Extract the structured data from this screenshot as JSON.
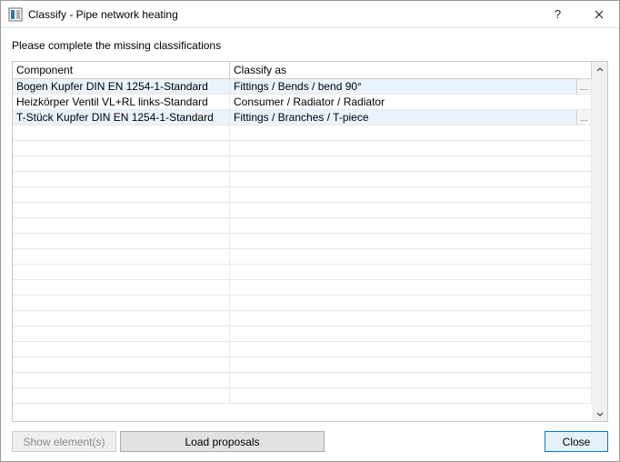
{
  "window": {
    "title": "Classify - Pipe network heating",
    "help_label": "?",
    "close_label": "Close"
  },
  "instruction": "Please complete the missing classifications",
  "grid": {
    "headers": {
      "component": "Component",
      "classify_as": "Classify as"
    },
    "rows": [
      {
        "component": "Bogen Kupfer DIN EN 1254-1-Standard",
        "classify_as": "Fittings / Bends / bend 90°",
        "highlight": true,
        "has_ellipsis": true
      },
      {
        "component": "Heizkörper Ventil VL+RL links-Standard",
        "classify_as": "Consumer / Radiator / Radiator",
        "highlight": false,
        "has_ellipsis": false
      },
      {
        "component": "T-Stück Kupfer DIN EN 1254-1-Standard",
        "classify_as": "Fittings / Branches / T-piece",
        "highlight": true,
        "has_ellipsis": true
      }
    ],
    "ellipsis_label": "...",
    "empty_row_count": 18
  },
  "buttons": {
    "show_elements": "Show element(s)",
    "load_proposals": "Load proposals",
    "close": "Close"
  }
}
